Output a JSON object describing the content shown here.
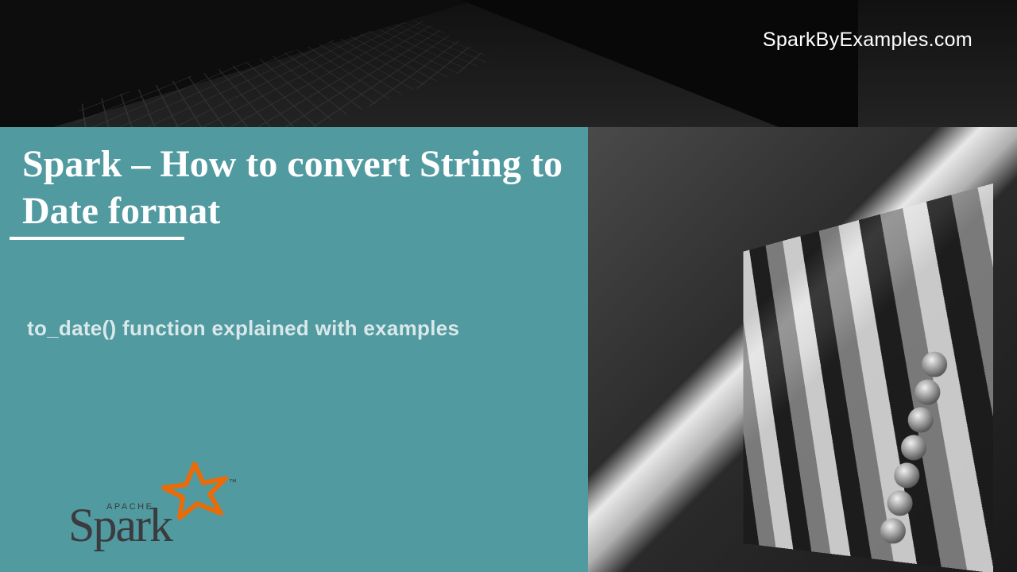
{
  "site": {
    "label": "SparkByExamples.com"
  },
  "title": "Spark – How to convert String to Date format",
  "subtitle": "to_date() function explained with examples",
  "logo": {
    "apache": "APACHE",
    "name": "Spark",
    "tm": "™"
  }
}
